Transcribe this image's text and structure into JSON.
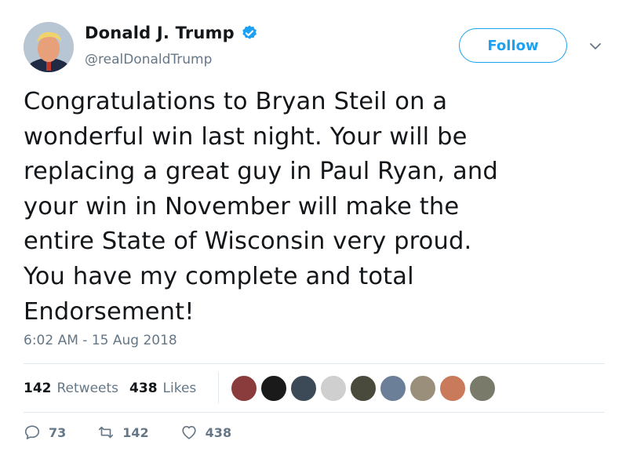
{
  "author": {
    "display_name": "Donald J. Trump",
    "handle": "@realDonaldTrump",
    "verified": true
  },
  "follow_label": "Follow",
  "tweet_lines": [
    "Congratulations to Bryan Steil on a",
    "wonderful win last night. Your will be",
    "replacing a great guy in Paul Ryan, and",
    "your win in November will make the",
    "entire State of Wisconsin very proud.",
    "You have my complete and total",
    "Endorsement!"
  ],
  "timestamp": "6:02 AM - 15 Aug 2018",
  "stats": {
    "retweets_count": "142",
    "retweets_label": "Retweets",
    "likes_count": "438",
    "likes_label": "Likes"
  },
  "actions": {
    "replies": "73",
    "retweets": "142",
    "likes": "438"
  },
  "colors": {
    "accent": "#1da1f2",
    "muted": "#657786",
    "text": "#14171a",
    "border": "#e1e8ed"
  },
  "liker_colors": [
    "#8a3b3b",
    "#1a1a1a",
    "#3c4a58",
    "#cfcfcf",
    "#4a4a3c",
    "#6b7f99",
    "#9a8f7a",
    "#c97a5a",
    "#7a7a6a"
  ]
}
